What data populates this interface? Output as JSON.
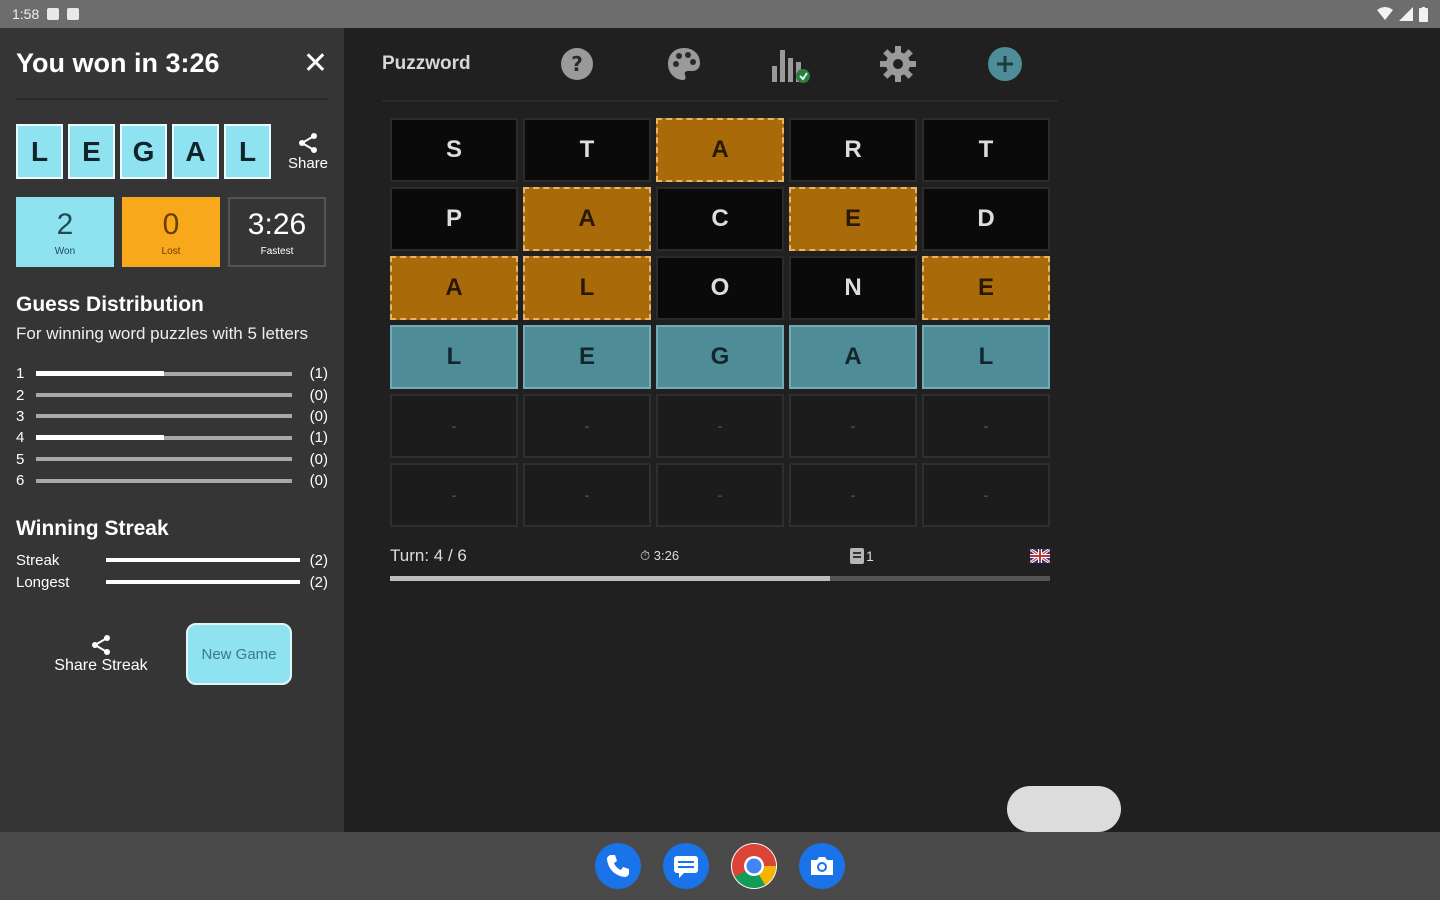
{
  "status": {
    "time": "1:58"
  },
  "panel": {
    "title": "You won in 3:26",
    "word": [
      "L",
      "E",
      "G",
      "A",
      "L"
    ],
    "share_label": "Share",
    "stats": [
      {
        "value": "2",
        "label": "Won"
      },
      {
        "value": "0",
        "label": "Lost"
      },
      {
        "value": "3:26",
        "label": "Fastest"
      }
    ],
    "guess_title": "Guess Distribution",
    "guess_subtitle": "For winning word puzzles with 5 letters",
    "distribution": [
      {
        "guess": "1",
        "count": "(1)",
        "fraction": 0.5
      },
      {
        "guess": "2",
        "count": "(0)",
        "fraction": 0
      },
      {
        "guess": "3",
        "count": "(0)",
        "fraction": 0
      },
      {
        "guess": "4",
        "count": "(1)",
        "fraction": 0.5
      },
      {
        "guess": "5",
        "count": "(0)",
        "fraction": 0
      },
      {
        "guess": "6",
        "count": "(0)",
        "fraction": 0
      }
    ],
    "streak_title": "Winning Streak",
    "streak": [
      {
        "label": "Streak",
        "count": "(2)"
      },
      {
        "label": "Longest",
        "count": "(2)"
      }
    ],
    "share_streak_label": "Share Streak",
    "new_game_label": "New Game"
  },
  "toolbar": {
    "app_name": "Puzzword"
  },
  "board": {
    "rows": [
      [
        {
          "letter": "S",
          "state": "absent"
        },
        {
          "letter": "T",
          "state": "absent"
        },
        {
          "letter": "A",
          "state": "present"
        },
        {
          "letter": "R",
          "state": "absent"
        },
        {
          "letter": "T",
          "state": "absent"
        }
      ],
      [
        {
          "letter": "P",
          "state": "absent"
        },
        {
          "letter": "A",
          "state": "present"
        },
        {
          "letter": "C",
          "state": "absent"
        },
        {
          "letter": "E",
          "state": "present"
        },
        {
          "letter": "D",
          "state": "absent"
        }
      ],
      [
        {
          "letter": "A",
          "state": "present"
        },
        {
          "letter": "L",
          "state": "present"
        },
        {
          "letter": "O",
          "state": "absent"
        },
        {
          "letter": "N",
          "state": "absent"
        },
        {
          "letter": "E",
          "state": "present"
        }
      ],
      [
        {
          "letter": "L",
          "state": "correct"
        },
        {
          "letter": "E",
          "state": "correct"
        },
        {
          "letter": "G",
          "state": "correct"
        },
        {
          "letter": "A",
          "state": "correct"
        },
        {
          "letter": "L",
          "state": "correct"
        }
      ],
      [
        {
          "letter": "-",
          "state": "empty"
        },
        {
          "letter": "-",
          "state": "empty"
        },
        {
          "letter": "-",
          "state": "empty"
        },
        {
          "letter": "-",
          "state": "empty"
        },
        {
          "letter": "-",
          "state": "empty"
        }
      ],
      [
        {
          "letter": "-",
          "state": "empty"
        },
        {
          "letter": "-",
          "state": "empty"
        },
        {
          "letter": "-",
          "state": "empty"
        },
        {
          "letter": "-",
          "state": "empty"
        },
        {
          "letter": "-",
          "state": "empty"
        }
      ]
    ]
  },
  "info": {
    "turn": "Turn: 4 / 6",
    "timer": "3:26",
    "hints": "1",
    "progress": 0.667
  },
  "colors": {
    "accent": "#8fe2f0",
    "present": "#a96b0a",
    "correct": "#4e8d98"
  }
}
